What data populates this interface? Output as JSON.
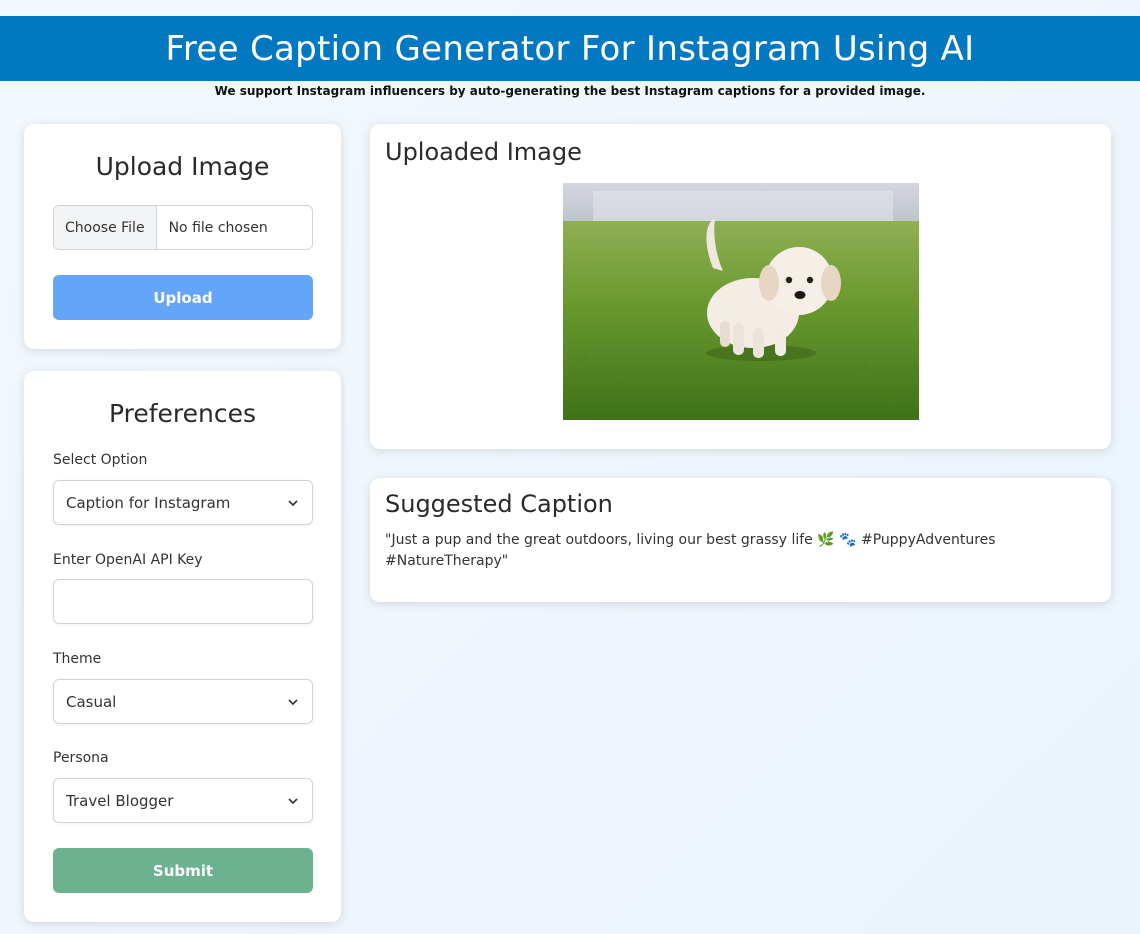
{
  "header": {
    "title": "Free Caption Generator For Instagram Using AI",
    "tagline": "We support Instagram influencers by auto-generating the best Instagram captions for a provided image."
  },
  "upload": {
    "title": "Upload Image",
    "choose_file_label": "Choose File",
    "file_status": "No file chosen",
    "upload_button": "Upload"
  },
  "preferences": {
    "title": "Preferences",
    "select_option_label": "Select Option",
    "select_option_value": "Caption for Instagram",
    "api_key_label": "Enter OpenAI API Key",
    "api_key_value": "",
    "theme_label": "Theme",
    "theme_value": "Casual",
    "persona_label": "Persona",
    "persona_value": "Travel Blogger",
    "submit_button": "Submit"
  },
  "uploaded_image": {
    "title": "Uploaded Image",
    "icon": "puppy-photo"
  },
  "suggested_caption": {
    "title": "Suggested Caption",
    "text": "\"Just a pup and the great outdoors, living our best grassy life 🌿 🐾 #PuppyAdventures #NatureTherapy\""
  },
  "colors": {
    "header_bg": "#0278c1",
    "upload_button": "#62a5f9",
    "submit_button": "#6db290"
  }
}
